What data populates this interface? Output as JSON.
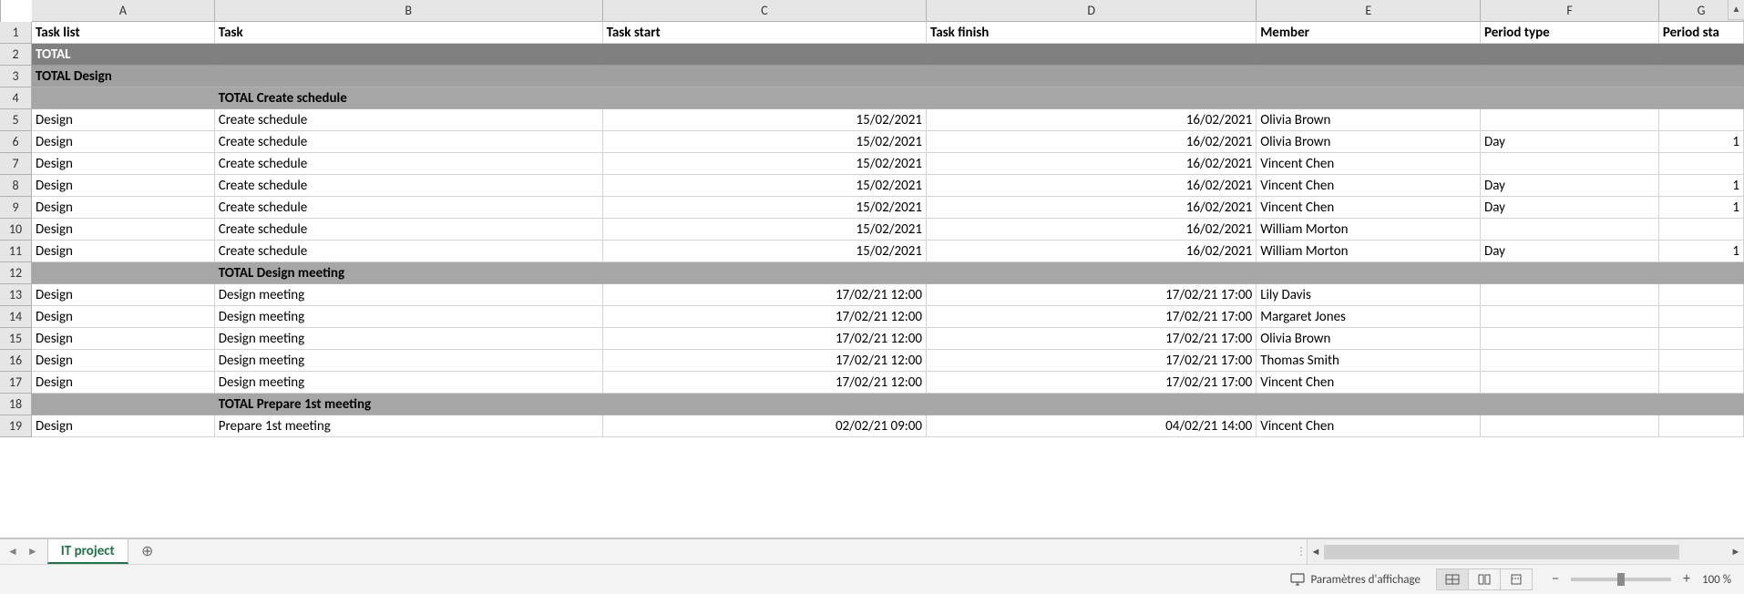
{
  "columns": [
    {
      "letter": "A",
      "class": "cA",
      "header": "Task list"
    },
    {
      "letter": "B",
      "class": "cB",
      "header": "Task"
    },
    {
      "letter": "C",
      "class": "cC",
      "header": "Task start"
    },
    {
      "letter": "D",
      "class": "cD",
      "header": "Task finish"
    },
    {
      "letter": "E",
      "class": "cE",
      "header": "Member"
    },
    {
      "letter": "F",
      "class": "cF",
      "header": "Period type"
    },
    {
      "letter": "G",
      "class": "cG",
      "header": "Period sta"
    }
  ],
  "rows": [
    {
      "n": 1,
      "type": "header",
      "cells": {
        "A": "Task list",
        "B": "Task",
        "C": "Task start",
        "D": "Task finish",
        "E": "Member",
        "F": "Period type",
        "G": "Period sta"
      }
    },
    {
      "n": 2,
      "type": "total",
      "cells": {
        "A": "TOTAL"
      }
    },
    {
      "n": 3,
      "type": "total-sub",
      "cells": {
        "A": "TOTAL Design"
      }
    },
    {
      "n": 4,
      "type": "total-group",
      "cells": {
        "B": "TOTAL Create schedule"
      }
    },
    {
      "n": 5,
      "type": "data",
      "cells": {
        "A": "Design",
        "B": "Create schedule",
        "C": "15/02/2021",
        "D": "16/02/2021",
        "E": "Olivia Brown"
      }
    },
    {
      "n": 6,
      "type": "data",
      "cells": {
        "A": "Design",
        "B": "Create schedule",
        "C": "15/02/2021",
        "D": "16/02/2021",
        "E": "Olivia Brown",
        "F": "Day",
        "G": "1"
      }
    },
    {
      "n": 7,
      "type": "data",
      "cells": {
        "A": "Design",
        "B": "Create schedule",
        "C": "15/02/2021",
        "D": "16/02/2021",
        "E": "Vincent Chen"
      }
    },
    {
      "n": 8,
      "type": "data",
      "cells": {
        "A": "Design",
        "B": "Create schedule",
        "C": "15/02/2021",
        "D": "16/02/2021",
        "E": "Vincent Chen",
        "F": "Day",
        "G": "1"
      }
    },
    {
      "n": 9,
      "type": "data",
      "cells": {
        "A": "Design",
        "B": "Create schedule",
        "C": "15/02/2021",
        "D": "16/02/2021",
        "E": "Vincent Chen",
        "F": "Day",
        "G": "1"
      }
    },
    {
      "n": 10,
      "type": "data",
      "cells": {
        "A": "Design",
        "B": "Create schedule",
        "C": "15/02/2021",
        "D": "16/02/2021",
        "E": "William Morton"
      }
    },
    {
      "n": 11,
      "type": "data",
      "cells": {
        "A": "Design",
        "B": "Create schedule",
        "C": "15/02/2021",
        "D": "16/02/2021",
        "E": "William Morton",
        "F": "Day",
        "G": "1"
      }
    },
    {
      "n": 12,
      "type": "total-group",
      "cells": {
        "B": "TOTAL Design meeting"
      }
    },
    {
      "n": 13,
      "type": "data",
      "cells": {
        "A": "Design",
        "B": "Design meeting",
        "C": "17/02/21 12:00",
        "D": "17/02/21 17:00",
        "E": "Lily Davis"
      }
    },
    {
      "n": 14,
      "type": "data",
      "cells": {
        "A": "Design",
        "B": "Design meeting",
        "C": "17/02/21 12:00",
        "D": "17/02/21 17:00",
        "E": "Margaret Jones"
      }
    },
    {
      "n": 15,
      "type": "data",
      "cells": {
        "A": "Design",
        "B": "Design meeting",
        "C": "17/02/21 12:00",
        "D": "17/02/21 17:00",
        "E": "Olivia Brown"
      }
    },
    {
      "n": 16,
      "type": "data",
      "cells": {
        "A": "Design",
        "B": "Design meeting",
        "C": "17/02/21 12:00",
        "D": "17/02/21 17:00",
        "E": "Thomas Smith"
      }
    },
    {
      "n": 17,
      "type": "data",
      "cells": {
        "A": "Design",
        "B": "Design meeting",
        "C": "17/02/21 12:00",
        "D": "17/02/21 17:00",
        "E": "Vincent Chen"
      }
    },
    {
      "n": 18,
      "type": "total-group",
      "cells": {
        "B": "TOTAL Prepare 1st meeting"
      }
    },
    {
      "n": 19,
      "type": "data",
      "cells": {
        "A": "Design",
        "B": "Prepare 1st meeting",
        "C": "02/02/21 09:00",
        "D": "04/02/21 14:00",
        "E": "Vincent Chen"
      }
    }
  ],
  "tabs": {
    "active": "IT project"
  },
  "status": {
    "display_settings_label": "Paramètres d'affichage",
    "zoom": "100 %"
  },
  "extra_row_numbers": []
}
